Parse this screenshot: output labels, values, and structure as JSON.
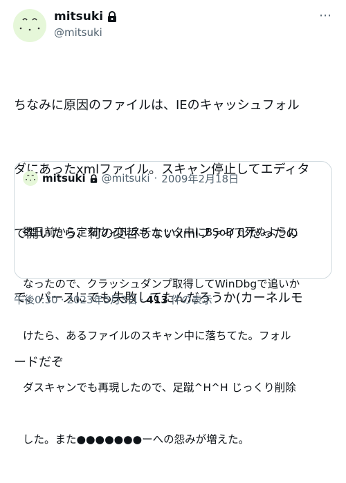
{
  "author": {
    "display_name": "mitsuki",
    "handle": "@mitsuki"
  },
  "menu_icon": "more-horizontal-icon",
  "tweet": {
    "lines": [
      "ちなみに原因のファイルは、IEのキャッシュフォル",
      "ダにあったxmlファイル。スキャン停止してエディタ",
      "で開いたら、何の変哲もないxmlファイルだったの",
      "で、パースにでも失敗してたんだろうか(カーネルモ",
      "ードだぞ"
    ]
  },
  "quote": {
    "display_name": "mitsuki",
    "handle": "@mitsuki",
    "separator": "·",
    "date": "2009年2月18日",
    "lines": [
      "数日前から定刻ウィルスチェック中にBSoDで死ぬように",
      "なったので、クラッシュダンプ取得してWinDbgで追いか",
      "けたら、あるファイルのスキャン中に落ちてた。フォル",
      "ダスキャンでも再現したので、足蹴^H^H じっくり削除",
      "した。また●●●●●●●ーへの怨みが増えた。"
    ]
  },
  "footer": {
    "time": "午後0:30",
    "separator": "·",
    "date": "2023年5月3日",
    "separator2": "·",
    "views_count": "413",
    "views_label": "件の表示"
  }
}
